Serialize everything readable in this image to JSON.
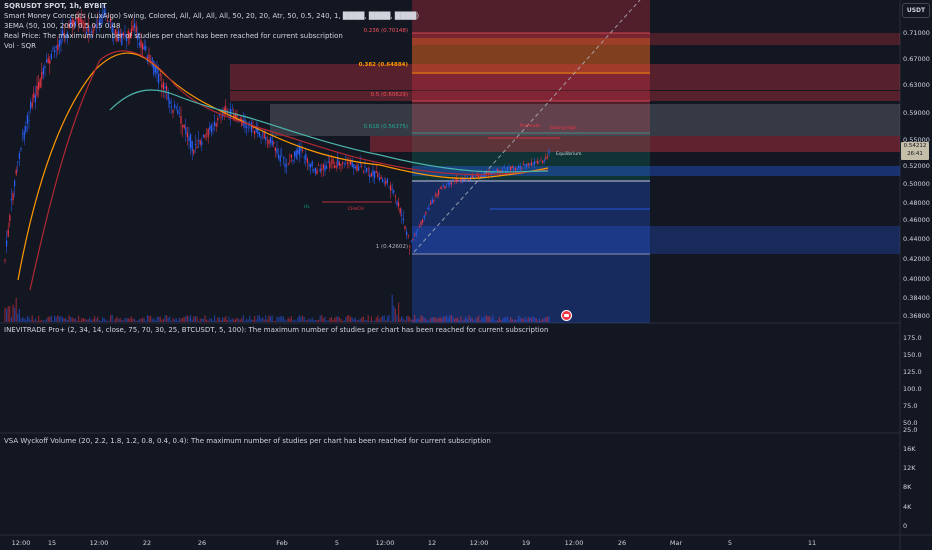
{
  "legend": {
    "line1": "SQRUSDT SPOT, 1h, BYBIT",
    "line2": "Smart Money Concepts (LuxAlgo) Swing, Colored, All, All, All, All, 50, 20, 20, Atr, 50, 0.5, 240, 1, ████, ████, ████)",
    "line3": "3EMA (50, 100, 200) 0.5 0.5 0.48",
    "line4": "Real Price: The maximum number of studies per chart has been reached for current subscription",
    "line5": "Vol · SQR"
  },
  "currency_badge": "USDT",
  "price_tag": {
    "price": "0.54212",
    "countdown": "26:41"
  },
  "price_axis": {
    "ticks": [
      "0.71000",
      "0.67000",
      "0.63000",
      "0.59000",
      "0.55000",
      "0.52000",
      "0.50000",
      "0.48000",
      "0.46000",
      "0.44000",
      "0.42000",
      "0.40000",
      "0.38400",
      "0.36800"
    ]
  },
  "fib_levels": [
    {
      "label": "0.236 (0.70148)",
      "color": "#f7525f"
    },
    {
      "label": "0.382 (0.64884)",
      "color": "#ff9800"
    },
    {
      "label": "0.5 (0.60629)",
      "color": "#f7525f"
    },
    {
      "label": "0.618 (0.56375)",
      "color": "#22ab94"
    },
    {
      "label": "1 (0.42602)",
      "color": "#b2b5be"
    }
  ],
  "smc_labels": {
    "choch": "CHoCH",
    "hl": "HL",
    "premium": "Premium",
    "equilibrium": "Equilibrium",
    "strong_high": "Strong High"
  },
  "pane2": {
    "legend": "INEVITRADE Pro+ (2, 34, 14, close, 75, 70, 30, 25, BTCUSDT, 5, 100): The maximum number of studies per chart has been reached for current subscription",
    "ticks": [
      "175.0",
      "150.0",
      "125.0",
      "100.0",
      "75.0",
      "50.0",
      "25.0"
    ]
  },
  "pane3": {
    "legend": "VSA Wyckoff Volume (20, 2.2, 1.8, 1.2, 0.8, 0.4, 0.4): The maximum number of studies per chart has been reached for current subscription",
    "ticks": [
      "16K",
      "12K",
      "8K",
      "4K",
      "0"
    ]
  },
  "time_axis": {
    "ticks": [
      "12:00",
      "15",
      "12:00",
      "22",
      "26",
      "Feb",
      "5",
      "12:00",
      "12",
      "12:00",
      "19",
      "12:00",
      "26",
      "Mar",
      "5",
      "11"
    ]
  },
  "colors": {
    "background": "#131722",
    "bull": "#2962ff",
    "bear": "#f23645",
    "premium_zone": "#f23645",
    "discount_zone": "#2962ff"
  }
}
